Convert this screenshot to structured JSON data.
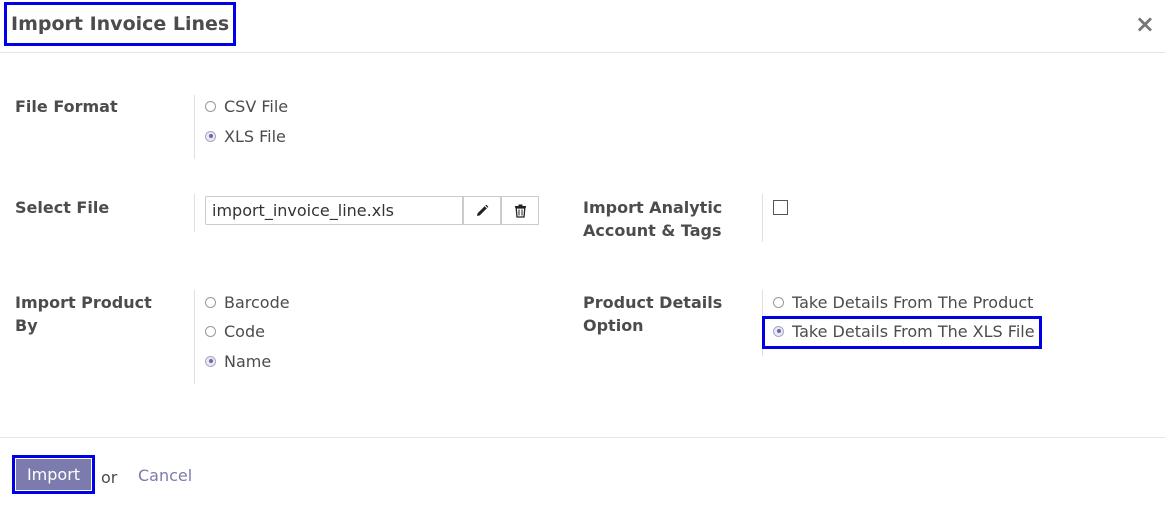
{
  "dialog": {
    "title": "Import Invoice Lines",
    "close_symbol": "×"
  },
  "file_format": {
    "label": "File Format",
    "options": [
      {
        "label": "CSV File",
        "selected": false
      },
      {
        "label": "XLS File",
        "selected": true
      }
    ]
  },
  "select_file": {
    "label": "Select File",
    "value": "import_invoice_line.xls",
    "edit_icon": "pencil-icon",
    "delete_icon": "trash-icon"
  },
  "analytic": {
    "label_line1": "Import Analytic",
    "label_line2": "Account & Tags",
    "checked": false
  },
  "import_product_by": {
    "label_line1": "Import Product",
    "label_line2": "By",
    "options": [
      {
        "label": "Barcode",
        "selected": false
      },
      {
        "label": "Code",
        "selected": false
      },
      {
        "label": "Name",
        "selected": true
      }
    ]
  },
  "product_details": {
    "label_line1": "Product Details",
    "label_line2": "Option",
    "options": [
      {
        "label": "Take Details From The Product",
        "selected": false
      },
      {
        "label": "Take Details From The XLS File",
        "selected": true
      }
    ]
  },
  "footer": {
    "import_label": "Import",
    "or_text": "or",
    "cancel_label": "Cancel"
  },
  "colors": {
    "primary": "#7c7bad",
    "highlight": "#0000e6"
  }
}
